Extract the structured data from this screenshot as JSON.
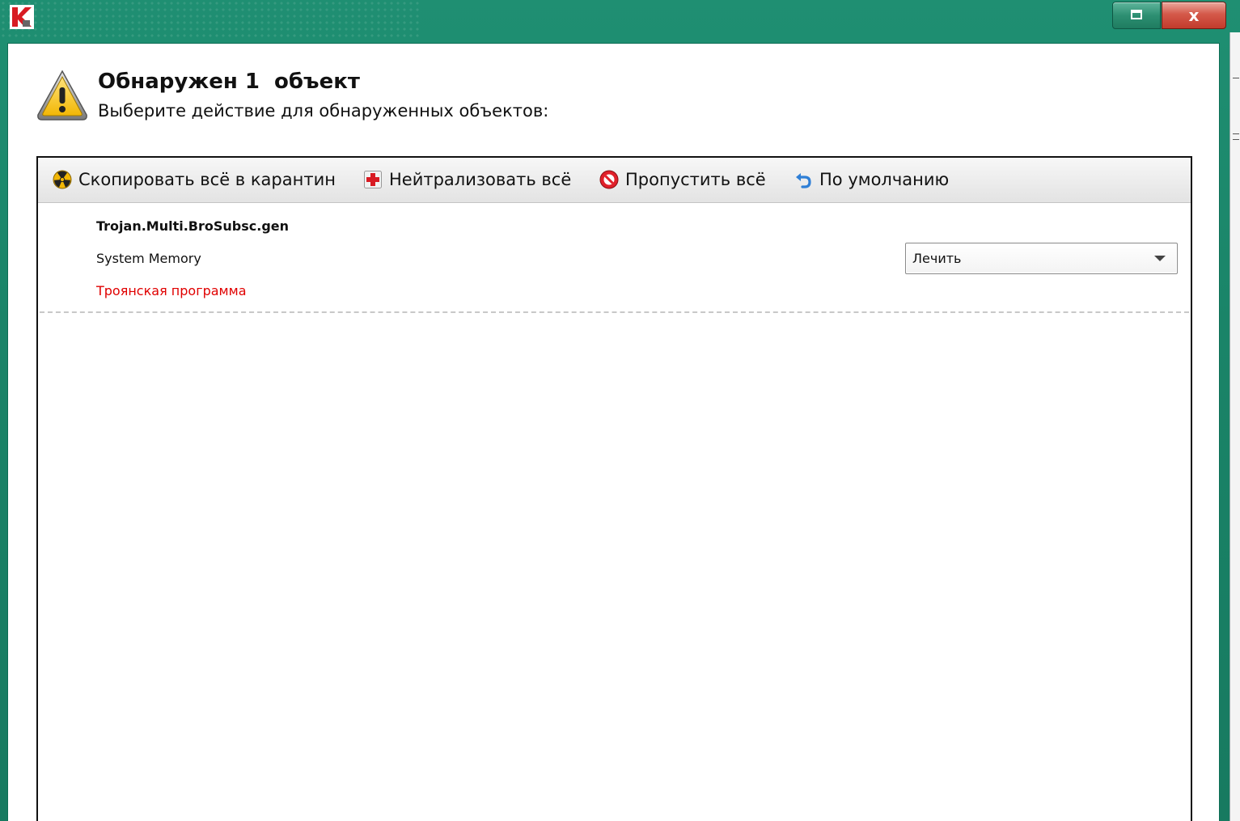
{
  "window": {
    "logo_icon": "kaspersky-k-logo",
    "restore_icon": "restore-window-icon",
    "close_glyph": "x",
    "frame_color": "#1b8769",
    "close_color": "#c9473a"
  },
  "header": {
    "icon": "warning-triangle-icon",
    "title": "Обнаружен 1  объект",
    "subtitle": "Выберите действие для обнаруженных объектов:"
  },
  "toolbar": {
    "quarantine_all": {
      "icon": "radiation-icon",
      "label": "Скопировать всё в карантин"
    },
    "neutralize_all": {
      "icon": "red-cross-icon",
      "label": "Нейтрализовать всё"
    },
    "skip_all": {
      "icon": "no-entry-icon",
      "label": "Пропустить всё"
    },
    "default": {
      "icon": "undo-arrow-icon",
      "label": "По умолчанию"
    }
  },
  "detections": [
    {
      "name": "Trojan.Multi.BroSubsc.gen",
      "location": "System Memory",
      "type": "Троянская программа",
      "type_color": "#e00000",
      "action": "Лечить"
    }
  ]
}
